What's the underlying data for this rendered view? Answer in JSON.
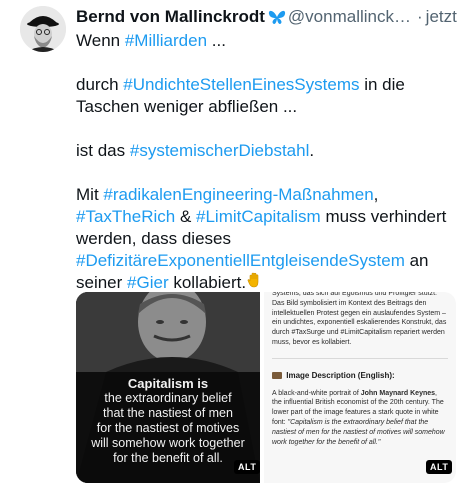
{
  "author": {
    "name": "Bernd von Mallinckrodt",
    "handle": "@vonmallinck…",
    "separator": "·",
    "time": "jetzt",
    "badge_icon": "blue-butterfly-icon"
  },
  "post": {
    "line1_pre": "Wenn ",
    "line1_tag": "#Milliarden",
    "line1_post": " ...",
    "p2_pre": "durch ",
    "p2_tag": "#UndichteStellenEinesSystems",
    "p2_post": " in die Taschen weniger abfließen ...",
    "p3_pre": "ist das ",
    "p3_tag": "#systemischerDiebstahl",
    "p3_post": ".",
    "p4_pre": "Mit ",
    "p4_tag1": "#radikalenEngineering-Maßnahmen",
    "p4_comma": ",",
    "p4_tag2": "#TaxTheRich",
    "p4_amp": " & ",
    "p4_tag3": "#LimitCapitalism",
    "p4_mid": " muss verhindert werden, dass dieses ",
    "p4_tag4": "#DefizitäreExponentiellEntgleisendeSystem",
    "p4_mid2": " an seiner ",
    "p4_tag5": "#Gier",
    "p4_end": " kollabiert.",
    "emoji_icon": "raised-hand-icon",
    "hashtag_color": "#1d9bf0"
  },
  "media": {
    "left": {
      "quote_title": "Capitalism is",
      "quote_lines": [
        "the extraordinary belief",
        "that the nastiest of men",
        "for the nastiest of motives",
        "will somehow work together",
        "for the benefit of all."
      ],
      "alt_label": "ALT"
    },
    "right": {
      "text_top": "Systems, das sich auf Egoismus und Profitgier stützt. Das Bild symbolisiert im Kontext des Beitrags den intellektuellen Protest gegen ein auslaufendes System – ein undichtes, exponentiell eskalierendes Konstrukt, das durch #TaxSurge und #LimitCapitalism repariert werden muss, bevor es kollabiert.",
      "heading": "Image Description (English):",
      "desc_pre": "A black-and-white portrait of ",
      "desc_name": "John Maynard Keynes",
      "desc_mid": ", the influential British economist of the 20th century. The lower part of the image features a stark quote in white font: ",
      "desc_quote": "\"Capitalism is the extraordinary belief that the nastiest of men for the nastiest of motives will somehow work together for the benefit of all.\"",
      "alt_label": "ALT"
    }
  }
}
